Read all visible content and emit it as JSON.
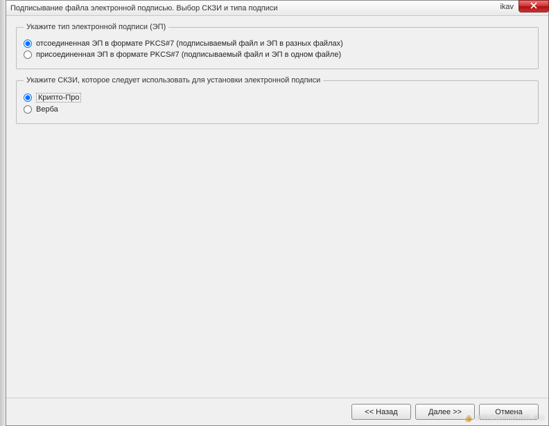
{
  "titlebar": {
    "title": "Подписывание файла электронной подписью. Выбор СКЗИ и типа подписи",
    "right_text": "ikav"
  },
  "group_signature": {
    "legend": "Укажите тип электронной подписи (ЭП)",
    "option_detached": "отсоединенная ЭП в формате PKCS#7 (подписываемый файл и ЭП в разных файлах)",
    "option_attached": "присоединенная ЭП в формате PKCS#7 (подписываемый файл и ЭП в одном файле)"
  },
  "group_skzi": {
    "legend": "Укажите СКЗИ, которое следует использовать для установки электронной подписи",
    "option_cryptoPro": "Крипто-Про",
    "option_verba": "Верба"
  },
  "buttons": {
    "back": "<< Назад",
    "next": "Далее >>",
    "cancel": "Отмена"
  },
  "watermark": "IRECOMMEND.RU"
}
